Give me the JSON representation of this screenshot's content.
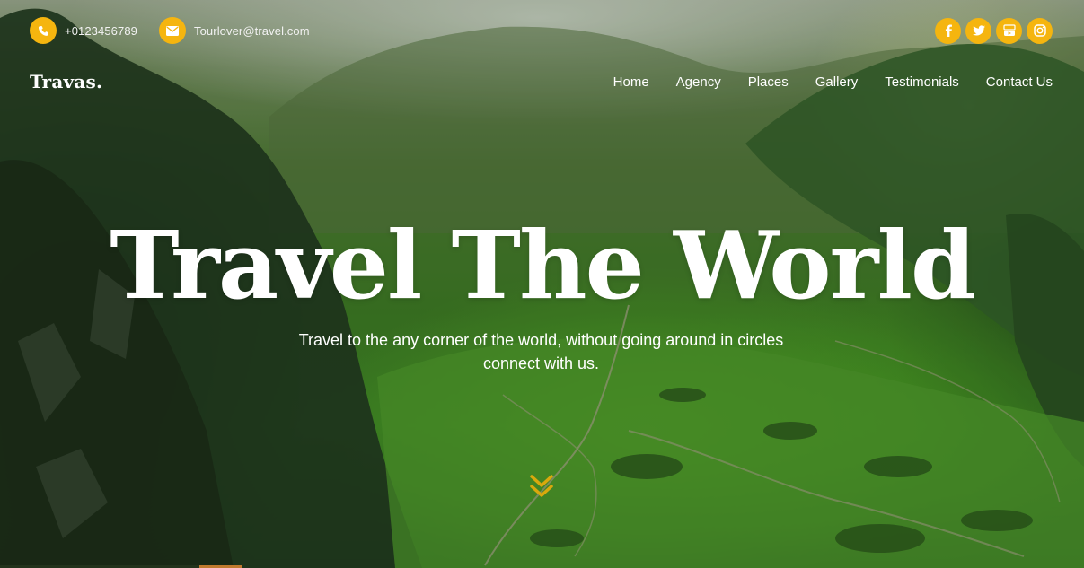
{
  "topbar": {
    "phone": "+0123456789",
    "phone_icon": "phone-icon",
    "email": "Tourlover@travel.com",
    "email_icon": "envelope-icon",
    "socials": [
      {
        "name": "facebook-icon"
      },
      {
        "name": "twitter-icon"
      },
      {
        "name": "youtube-icon"
      },
      {
        "name": "instagram-icon"
      }
    ]
  },
  "brand": {
    "logo": "Travas."
  },
  "nav": {
    "items": [
      {
        "label": "Home"
      },
      {
        "label": "Agency"
      },
      {
        "label": "Places"
      },
      {
        "label": "Gallery"
      },
      {
        "label": "Testimonials"
      },
      {
        "label": "Contact Us"
      }
    ]
  },
  "hero": {
    "title": "Travel The World",
    "subtitle": "Travel to the any corner of the world, without going around in circles connect with us.",
    "scroll_icon": "double-chevron-down-icon"
  },
  "colors": {
    "accent": "#f5b50f",
    "text": "#ffffff"
  }
}
